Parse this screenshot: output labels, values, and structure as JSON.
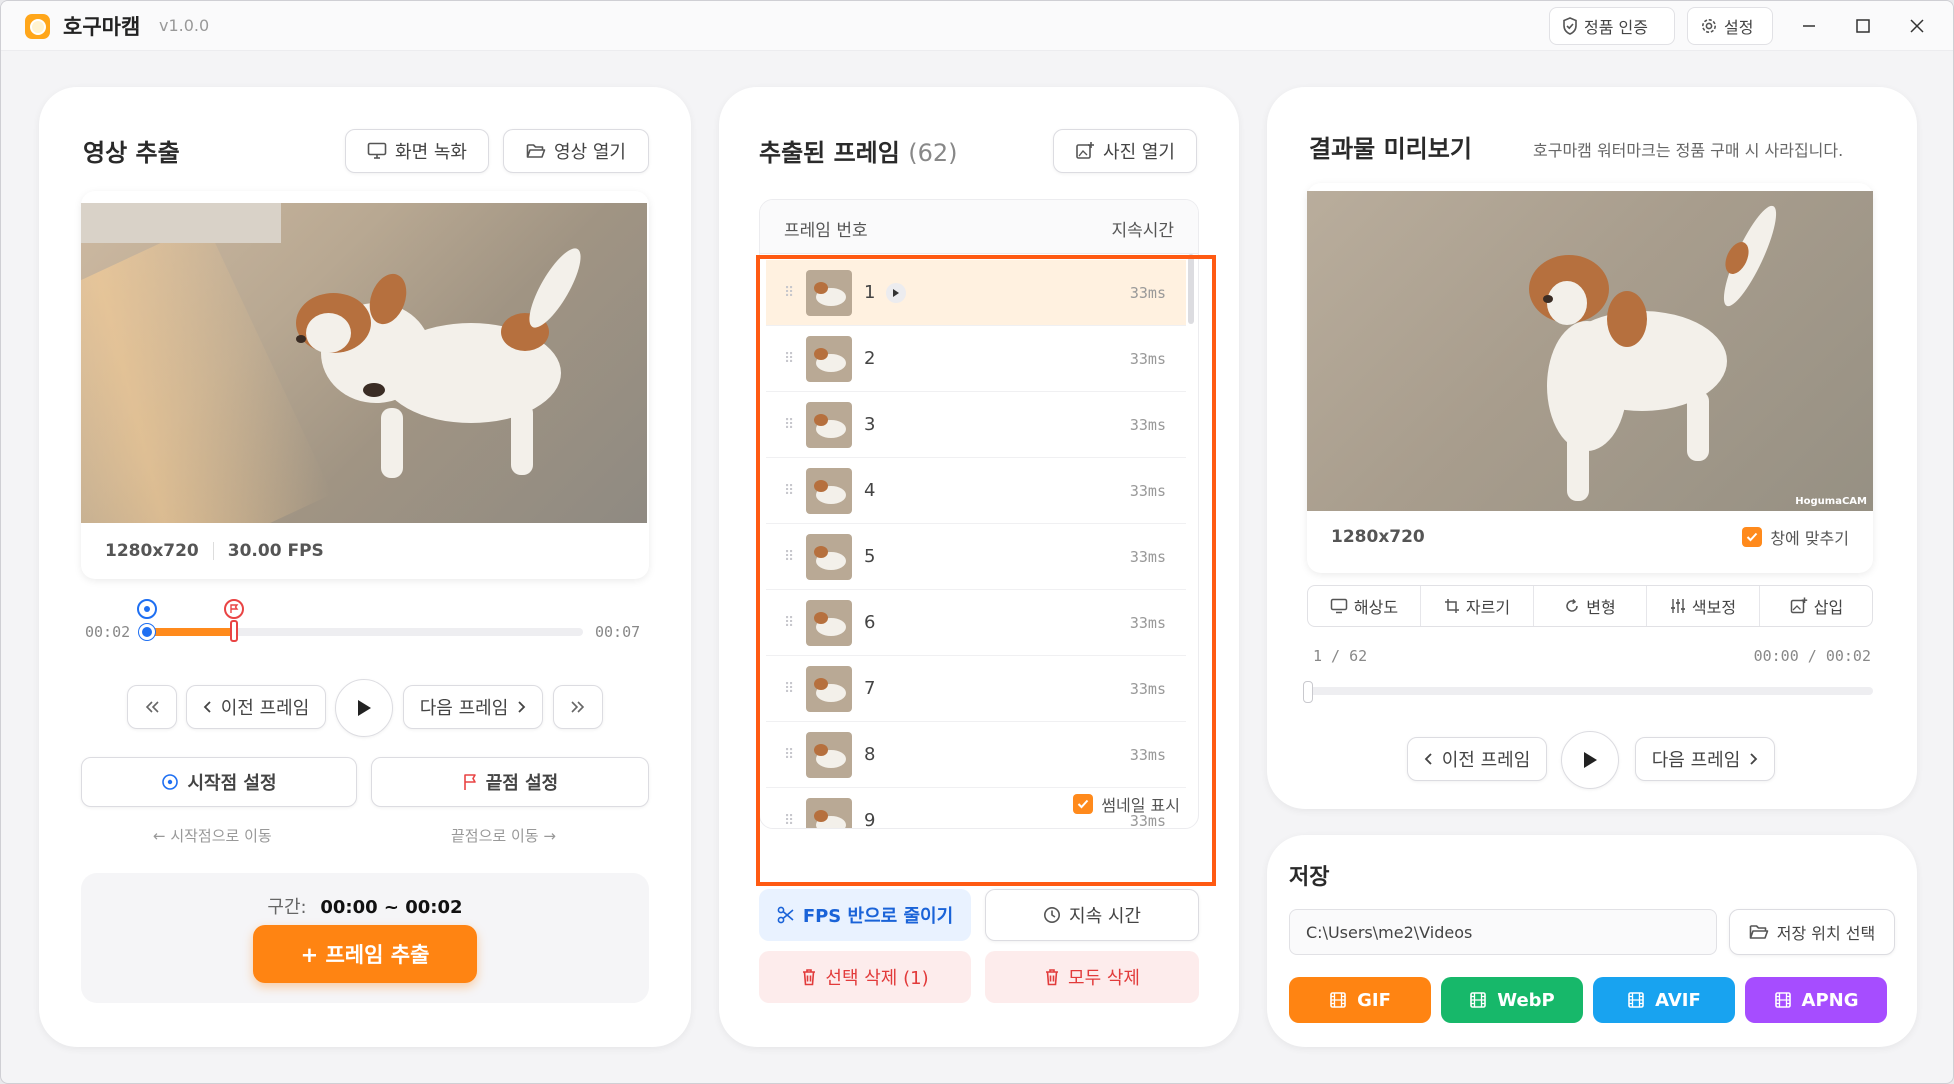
{
  "app": {
    "name": "호구마캠",
    "version": "v1.0.0"
  },
  "titlebar": {
    "activate_label": "정품 인증",
    "settings_label": "설정"
  },
  "extract_panel": {
    "title": "영상 추출",
    "record_label": "화면 녹화",
    "open_video_label": "영상 열기",
    "resolution": "1280x720",
    "fps": "30.00 FPS",
    "time_start": "00:02",
    "time_end": "00:07",
    "range_start_fraction": 0.0,
    "range_end_fraction": 0.2,
    "prev_frame_label": "이전 프레임",
    "next_frame_label": "다음 프레임",
    "set_start_label": "시작점 설정",
    "set_end_label": "끝점 설정",
    "goto_start_label": "← 시작점으로 이동",
    "goto_end_label": "끝점으로 이동 →",
    "range_label": "구간:",
    "range_value": "00:00 ~ 00:02",
    "extract_button_label": "+ 프레임 추출"
  },
  "frames_panel": {
    "title": "추출된 프레임",
    "count": "(62)",
    "open_photo_label": "사진 열기",
    "col_frame": "프레임 번호",
    "col_duration": "지속시간",
    "frames": [
      {
        "num": "1",
        "dur": "33ms"
      },
      {
        "num": "2",
        "dur": "33ms"
      },
      {
        "num": "3",
        "dur": "33ms"
      },
      {
        "num": "4",
        "dur": "33ms"
      },
      {
        "num": "5",
        "dur": "33ms"
      },
      {
        "num": "6",
        "dur": "33ms"
      },
      {
        "num": "7",
        "dur": "33ms"
      },
      {
        "num": "8",
        "dur": "33ms"
      },
      {
        "num": "9",
        "dur": "33ms"
      }
    ],
    "show_thumbs_label": "썸네일 표시",
    "halve_fps_label": "FPS 반으로 줄이기",
    "duration_label": "지속 시간",
    "delete_selected_label": "선택 삭제 (1)",
    "delete_all_label": "모두 삭제"
  },
  "preview_panel": {
    "title": "결과물 미리보기",
    "watermark_note": "호구마캠 워터마크는 정품 구매 시 사라집니다.",
    "watermark": "HogumaCAM",
    "resolution": "1280x720",
    "fit_label": "창에 맞추기",
    "tools": [
      "해상도",
      "자르기",
      "변형",
      "색보정",
      "삽입"
    ],
    "frame_counter": "1 / 62",
    "time_counter": "00:00 / 00:02",
    "prev_frame_label": "이전 프레임",
    "next_frame_label": "다음 프레임"
  },
  "save_panel": {
    "title": "저장",
    "path": "C:\\Users\\me2\\Videos",
    "choose_location_label": "저장 위치 선택",
    "formats": [
      {
        "label": "GIF",
        "color": "#ff8412"
      },
      {
        "label": "WebP",
        "color": "#17b86a"
      },
      {
        "label": "AVIF",
        "color": "#18a3f0"
      },
      {
        "label": "APNG",
        "color": "#a64dff"
      }
    ]
  },
  "colors": {
    "accent": "#ff8412",
    "highlight_border": "#ff5a12",
    "selected_row": "#fff1e0"
  }
}
